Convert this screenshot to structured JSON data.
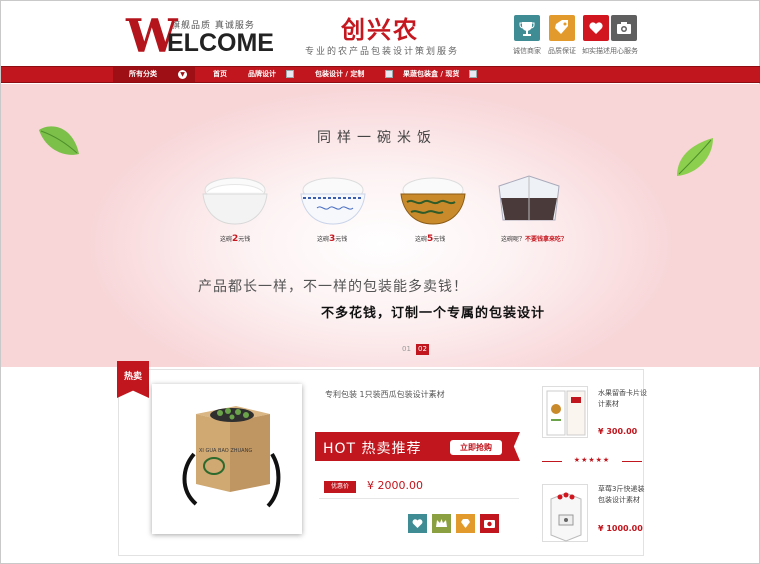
{
  "header": {
    "logo_tagline": "旗舰品质 真诚服务",
    "logo_w": "W",
    "logo_rest": "ELCOME",
    "brand": "创兴农",
    "slogan": "专业的农产品包装设计策划服务",
    "trust_badges": [
      {
        "label": "诚信商家",
        "icon": "trophy-icon",
        "color": "#3f8c94"
      },
      {
        "label": "品质保证",
        "icon": "tag-icon",
        "color": "#e39a2c"
      },
      {
        "label": "如实描述",
        "icon": "heart-icon",
        "color": "#d1161f"
      },
      {
        "label": "用心服务",
        "icon": "camera-icon",
        "color": "#5f5f5f"
      }
    ]
  },
  "nav": {
    "category": "所有分类",
    "items": [
      "首页",
      "品牌设计",
      "包装设计 / 定制",
      "果蔬包装盒 / 现货"
    ]
  },
  "banner": {
    "title": "同样一碗米饭",
    "bowls": [
      {
        "pre": "这碗",
        "price": "2",
        "post": "元钱"
      },
      {
        "pre": "这碗",
        "price": "3",
        "post": "元钱"
      },
      {
        "pre": "这碗",
        "price": "5",
        "post": "元钱"
      },
      {
        "pre": "这碗呢？",
        "price": "不要钱拿来吃？",
        "post": ""
      }
    ],
    "line1": "产品都长一样，不一样的包装能多卖钱！",
    "line2": "不多花钱，订制一个专属的包装设计",
    "pages": [
      "01",
      "02"
    ],
    "active_page": "02"
  },
  "product": {
    "ribbon": "热卖",
    "title": "专利包装 1只装西瓜包装设计素材",
    "hot_label": "HOT 热卖推荐",
    "buy_button": "立即抢购",
    "price_tag": "优惠价",
    "price": "¥ 2000.00",
    "actions": [
      {
        "icon": "heart-icon",
        "color": "#3f8c94"
      },
      {
        "icon": "crown-icon",
        "color": "#8ba040"
      },
      {
        "icon": "diamond-icon",
        "color": "#e39a2c"
      },
      {
        "icon": "camera-icon",
        "color": "#c1161e"
      }
    ],
    "box_label": "XI GUA BAO ZHUANG"
  },
  "sidebar": {
    "items": [
      {
        "title": "水果留香卡片设计素材",
        "price": "¥ 300.00"
      },
      {
        "title": "草莓3斤快递装包装设计素材",
        "price": "¥ 1000.00"
      }
    ],
    "stars": "★★★★★"
  }
}
